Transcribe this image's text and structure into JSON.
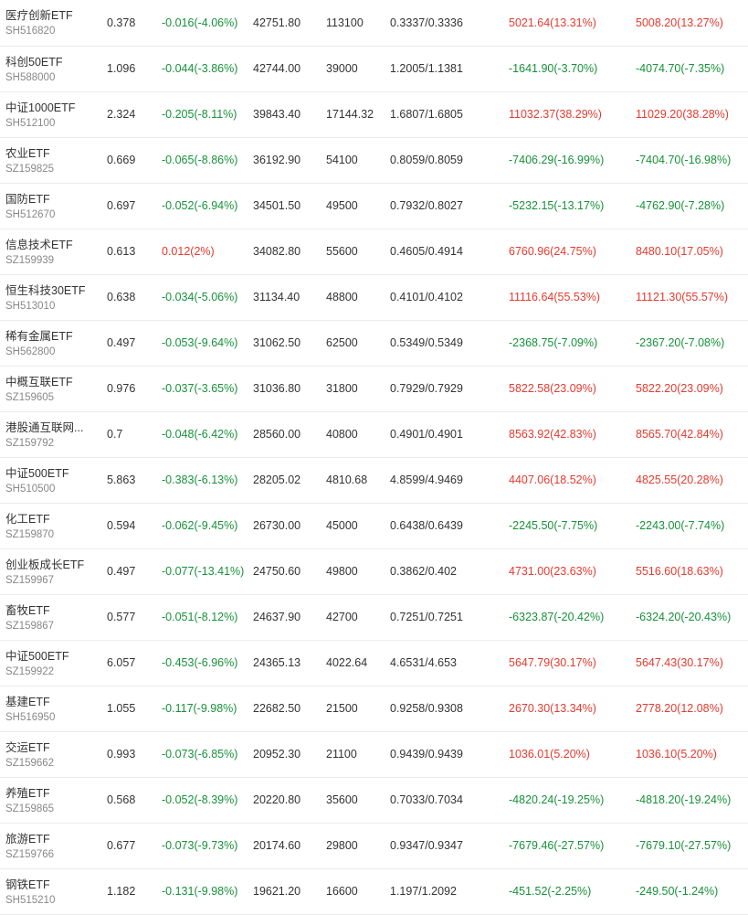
{
  "colors": {
    "up": "#e53a2f",
    "down": "#17913a",
    "text": "#333333",
    "subtext": "#888888",
    "divider": "#ececec"
  },
  "rows": [
    {
      "name": "医疗创新ETF",
      "code": "SH516820",
      "price": "0.378",
      "change": "-0.016(-4.06%)",
      "change_dir": "neg",
      "col4": "42751.80",
      "col5": "113100",
      "col6": "0.3337/0.3336",
      "pl1": "5021.64(13.31%)",
      "pl1_dir": "pos",
      "pl2": "5008.20(13.27%)",
      "pl2_dir": "pos"
    },
    {
      "name": "科创50ETF",
      "code": "SH588000",
      "price": "1.096",
      "change": "-0.044(-3.86%)",
      "change_dir": "neg",
      "col4": "42744.00",
      "col5": "39000",
      "col6": "1.2005/1.1381",
      "pl1": "-1641.90(-3.70%)",
      "pl1_dir": "neg",
      "pl2": "-4074.70(-7.35%)",
      "pl2_dir": "neg"
    },
    {
      "name": "中证1000ETF",
      "code": "SH512100",
      "price": "2.324",
      "change": "-0.205(-8.11%)",
      "change_dir": "neg",
      "col4": "39843.40",
      "col5": "17144.32",
      "col6": "1.6807/1.6805",
      "pl1": "11032.37(38.29%)",
      "pl1_dir": "pos",
      "pl2": "11029.20(38.28%)",
      "pl2_dir": "pos"
    },
    {
      "name": "农业ETF",
      "code": "SZ159825",
      "price": "0.669",
      "change": "-0.065(-8.86%)",
      "change_dir": "neg",
      "col4": "36192.90",
      "col5": "54100",
      "col6": "0.8059/0.8059",
      "pl1": "-7406.29(-16.99%)",
      "pl1_dir": "neg",
      "pl2": "-7404.70(-16.98%)",
      "pl2_dir": "neg"
    },
    {
      "name": "国防ETF",
      "code": "SH512670",
      "price": "0.697",
      "change": "-0.052(-6.94%)",
      "change_dir": "neg",
      "col4": "34501.50",
      "col5": "49500",
      "col6": "0.7932/0.8027",
      "pl1": "-5232.15(-13.17%)",
      "pl1_dir": "neg",
      "pl2": "-4762.90(-7.28%)",
      "pl2_dir": "neg"
    },
    {
      "name": "信息技术ETF",
      "code": "SZ159939",
      "price": "0.613",
      "change": "0.012(2%)",
      "change_dir": "pos",
      "col4": "34082.80",
      "col5": "55600",
      "col6": "0.4605/0.4914",
      "pl1": "6760.96(24.75%)",
      "pl1_dir": "pos",
      "pl2": "8480.10(17.05%)",
      "pl2_dir": "pos"
    },
    {
      "name": "恒生科技30ETF",
      "code": "SH513010",
      "price": "0.638",
      "change": "-0.034(-5.06%)",
      "change_dir": "neg",
      "col4": "31134.40",
      "col5": "48800",
      "col6": "0.4101/0.4102",
      "pl1": "11116.64(55.53%)",
      "pl1_dir": "pos",
      "pl2": "11121.30(55.57%)",
      "pl2_dir": "pos"
    },
    {
      "name": "稀有金属ETF",
      "code": "SH562800",
      "price": "0.497",
      "change": "-0.053(-9.64%)",
      "change_dir": "neg",
      "col4": "31062.50",
      "col5": "62500",
      "col6": "0.5349/0.5349",
      "pl1": "-2368.75(-7.09%)",
      "pl1_dir": "neg",
      "pl2": "-2367.20(-7.08%)",
      "pl2_dir": "neg"
    },
    {
      "name": "中概互联ETF",
      "code": "SZ159605",
      "price": "0.976",
      "change": "-0.037(-3.65%)",
      "change_dir": "neg",
      "col4": "31036.80",
      "col5": "31800",
      "col6": "0.7929/0.7929",
      "pl1": "5822.58(23.09%)",
      "pl1_dir": "pos",
      "pl2": "5822.20(23.09%)",
      "pl2_dir": "pos"
    },
    {
      "name": "港股通互联网...",
      "code": "SZ159792",
      "price": "0.7",
      "change": "-0.048(-6.42%)",
      "change_dir": "neg",
      "col4": "28560.00",
      "col5": "40800",
      "col6": "0.4901/0.4901",
      "pl1": "8563.92(42.83%)",
      "pl1_dir": "pos",
      "pl2": "8565.70(42.84%)",
      "pl2_dir": "pos"
    },
    {
      "name": "中证500ETF",
      "code": "SH510500",
      "price": "5.863",
      "change": "-0.383(-6.13%)",
      "change_dir": "neg",
      "col4": "28205.02",
      "col5": "4810.68",
      "col6": "4.8599/4.9469",
      "pl1": "4407.06(18.52%)",
      "pl1_dir": "pos",
      "pl2": "4825.55(20.28%)",
      "pl2_dir": "pos"
    },
    {
      "name": "化工ETF",
      "code": "SZ159870",
      "price": "0.594",
      "change": "-0.062(-9.45%)",
      "change_dir": "neg",
      "col4": "26730.00",
      "col5": "45000",
      "col6": "0.6438/0.6439",
      "pl1": "-2245.50(-7.75%)",
      "pl1_dir": "neg",
      "pl2": "-2243.00(-7.74%)",
      "pl2_dir": "neg"
    },
    {
      "name": "创业板成长ETF",
      "code": "SZ159967",
      "price": "0.497",
      "change": "-0.077(-13.41%)",
      "change_dir": "neg",
      "col4": "24750.60",
      "col5": "49800",
      "col6": "0.3862/0.402",
      "pl1": "4731.00(23.63%)",
      "pl1_dir": "pos",
      "pl2": "5516.60(18.63%)",
      "pl2_dir": "pos"
    },
    {
      "name": "畜牧ETF",
      "code": "SZ159867",
      "price": "0.577",
      "change": "-0.051(-8.12%)",
      "change_dir": "neg",
      "col4": "24637.90",
      "col5": "42700",
      "col6": "0.7251/0.7251",
      "pl1": "-6323.87(-20.42%)",
      "pl1_dir": "neg",
      "pl2": "-6324.20(-20.43%)",
      "pl2_dir": "neg"
    },
    {
      "name": "中证500ETF",
      "code": "SZ159922",
      "price": "6.057",
      "change": "-0.453(-6.96%)",
      "change_dir": "neg",
      "col4": "24365.13",
      "col5": "4022.64",
      "col6": "4.6531/4.653",
      "pl1": "5647.79(30.17%)",
      "pl1_dir": "pos",
      "pl2": "5647.43(30.17%)",
      "pl2_dir": "pos"
    },
    {
      "name": "基建ETF",
      "code": "SH516950",
      "price": "1.055",
      "change": "-0.117(-9.98%)",
      "change_dir": "neg",
      "col4": "22682.50",
      "col5": "21500",
      "col6": "0.9258/0.9308",
      "pl1": "2670.30(13.34%)",
      "pl1_dir": "pos",
      "pl2": "2778.20(12.08%)",
      "pl2_dir": "pos"
    },
    {
      "name": "交运ETF",
      "code": "SZ159662",
      "price": "0.993",
      "change": "-0.073(-6.85%)",
      "change_dir": "neg",
      "col4": "20952.30",
      "col5": "21100",
      "col6": "0.9439/0.9439",
      "pl1": "1036.01(5.20%)",
      "pl1_dir": "pos",
      "pl2": "1036.10(5.20%)",
      "pl2_dir": "pos"
    },
    {
      "name": "养殖ETF",
      "code": "SZ159865",
      "price": "0.568",
      "change": "-0.052(-8.39%)",
      "change_dir": "neg",
      "col4": "20220.80",
      "col5": "35600",
      "col6": "0.7033/0.7034",
      "pl1": "-4820.24(-19.25%)",
      "pl1_dir": "neg",
      "pl2": "-4818.20(-19.24%)",
      "pl2_dir": "neg"
    },
    {
      "name": "旅游ETF",
      "code": "SZ159766",
      "price": "0.677",
      "change": "-0.073(-9.73%)",
      "change_dir": "neg",
      "col4": "20174.60",
      "col5": "29800",
      "col6": "0.9347/0.9347",
      "pl1": "-7679.46(-27.57%)",
      "pl1_dir": "neg",
      "pl2": "-7679.10(-27.57%)",
      "pl2_dir": "neg"
    },
    {
      "name": "钢铁ETF",
      "code": "SH515210",
      "price": "1.182",
      "change": "-0.131(-9.98%)",
      "change_dir": "neg",
      "col4": "19621.20",
      "col5": "16600",
      "col6": "1.197/1.2092",
      "pl1": "-451.52(-2.25%)",
      "pl1_dir": "neg",
      "pl2": "-249.50(-1.24%)",
      "pl2_dir": "neg"
    }
  ]
}
